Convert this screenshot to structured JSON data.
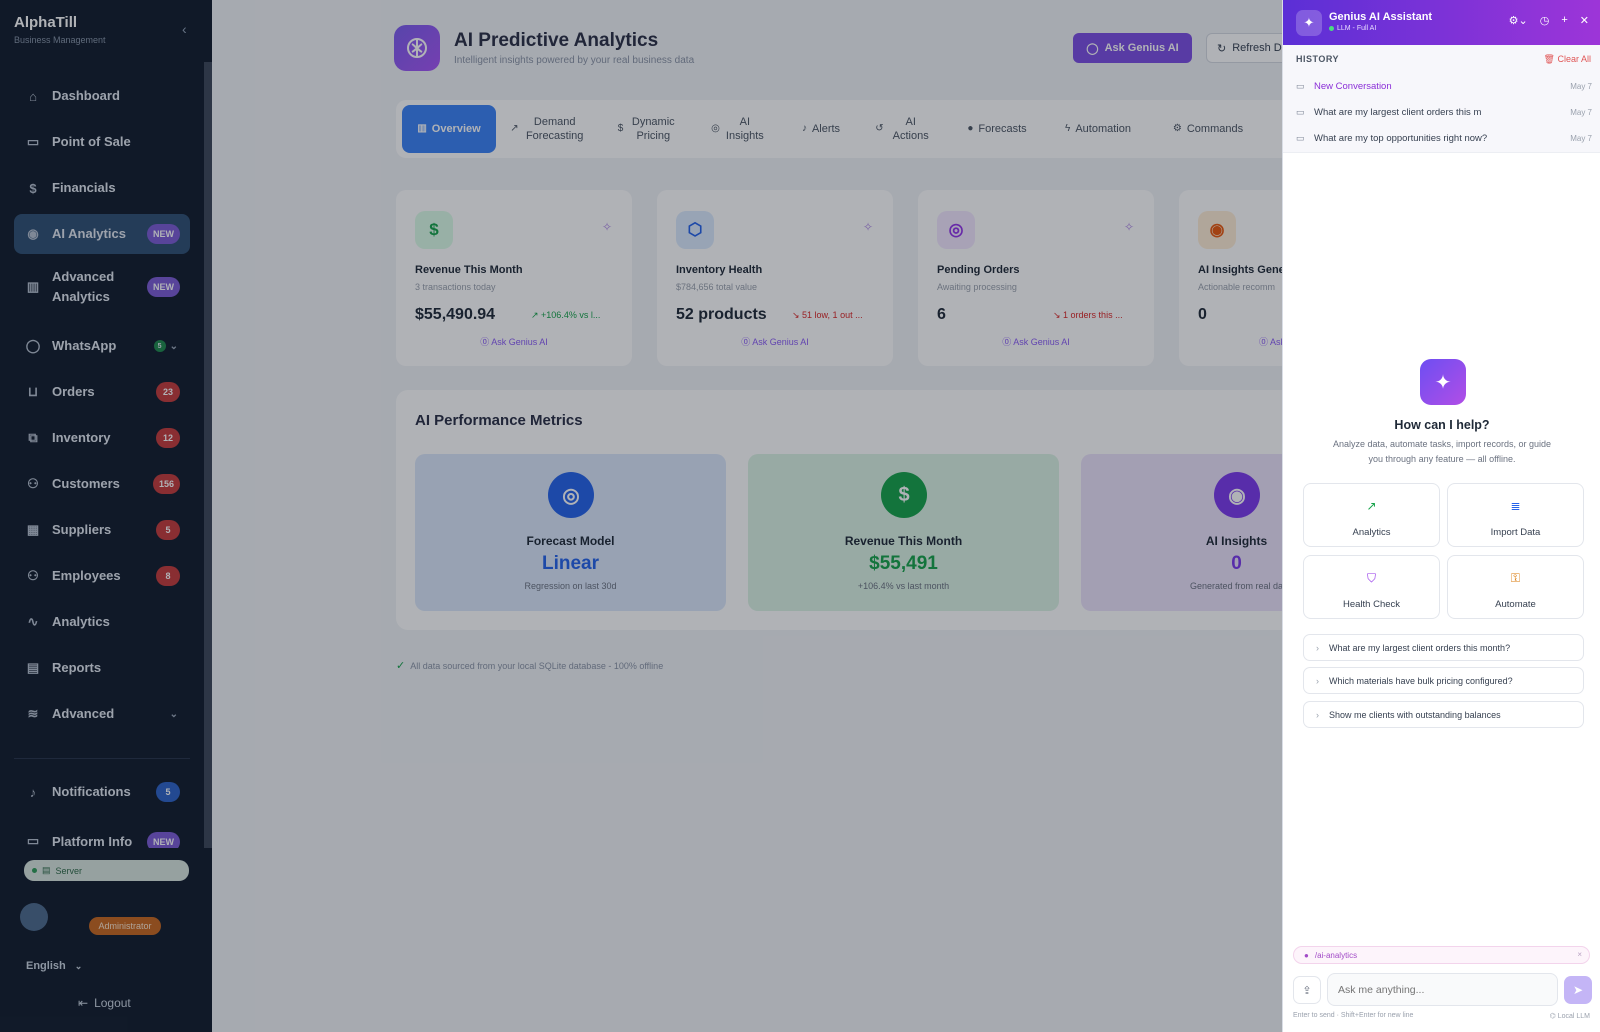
{
  "sidebar": {
    "brand_name": "AlphaTill",
    "brand_sub": "Business Management",
    "collapse_icon": "‹",
    "items": [
      {
        "label": "Dashboard",
        "icon": "⌂"
      },
      {
        "label": "Point of Sale",
        "icon": "▭"
      },
      {
        "label": "Financials",
        "icon": "$"
      },
      {
        "label": "AI Analytics",
        "icon": "◉",
        "badge": "NEW"
      },
      {
        "label": "Advanced Analytics",
        "icon": "▥",
        "badge": "NEW"
      },
      {
        "label": "WhatsApp",
        "icon": "◯",
        "badge": "5"
      },
      {
        "label": "Orders",
        "icon": "⊔",
        "badge": "23"
      },
      {
        "label": "Inventory",
        "icon": "⧉",
        "badge": "12"
      },
      {
        "label": "Customers",
        "icon": "⚇",
        "badge": "156"
      },
      {
        "label": "Suppliers",
        "icon": "▦",
        "badge": "5"
      },
      {
        "label": "Employees",
        "icon": "⚇",
        "badge": "8"
      },
      {
        "label": "Analytics",
        "icon": "∿"
      },
      {
        "label": "Reports",
        "icon": "▤"
      },
      {
        "label": "Advanced",
        "icon": "≋"
      },
      {
        "label": "Notifications",
        "icon": "♪",
        "badge": "5"
      },
      {
        "label": "Platform Info",
        "icon": "▭",
        "badge": "NEW"
      }
    ],
    "server_label": "Server",
    "role": "Administrator",
    "language": "English",
    "logout": "Logout"
  },
  "header": {
    "title": "AI Predictive Analytics",
    "subtitle": "Intelligent insights powered by your real business data",
    "ask_button": "Ask Genius AI",
    "refresh_button": "Refresh D"
  },
  "tabs": [
    {
      "label": "Overview",
      "icon": "▥"
    },
    {
      "label": "Demand Forecasting",
      "icon": "↗"
    },
    {
      "label": "Dynamic Pricing",
      "icon": "$"
    },
    {
      "label": "AI Insights",
      "icon": "◎"
    },
    {
      "label": "Alerts",
      "icon": "♪"
    },
    {
      "label": "AI Actions",
      "icon": "↺"
    },
    {
      "label": "Forecasts",
      "icon": "●"
    },
    {
      "label": "Automation",
      "icon": "ϟ"
    },
    {
      "label": "Commands",
      "icon": "⚙"
    }
  ],
  "stat_cards": [
    {
      "title": "Revenue This Month",
      "sub": "3 transactions today",
      "value": "$55,490.94",
      "trend": "↗ +106.4% vs l...",
      "ask": "⓪ Ask Genius AI",
      "icon": "$",
      "color": "#16a34a"
    },
    {
      "title": "Inventory Health",
      "sub": "$784,656 total value",
      "value": "52 products",
      "trend": "↘ 51 low, 1 out ...",
      "ask": "⓪ Ask Genius AI",
      "icon": "⬡",
      "color": "#2563eb"
    },
    {
      "title": "Pending Orders",
      "sub": "Awaiting processing",
      "value": "6",
      "trend": "↘ 1 orders this ...",
      "ask": "⓪ Ask Genius AI",
      "icon": "◎",
      "color": "#9333ea"
    },
    {
      "title": "AI Insights Gene",
      "sub": "Actionable recomm",
      "value": "0",
      "ask": "⓪ Ask",
      "icon": "◉",
      "color": "#ea580c"
    }
  ],
  "metrics": {
    "title": "AI Performance Metrics",
    "items": [
      {
        "label": "Forecast Model",
        "value": "Linear",
        "sub": "Regression on last 30d",
        "icon": "◎",
        "color": "#2563eb",
        "bg": "#dbe8fb"
      },
      {
        "label": "Revenue This Month",
        "value": "$55,491",
        "sub": "+106.4% vs last month",
        "icon": "$",
        "color": "#16a34a",
        "bg": "#dcf3e4"
      },
      {
        "label": "AI Insights",
        "value": "0",
        "sub": "Generated from real da",
        "icon": "◉",
        "color": "#7c3aed",
        "bg": "#ece3fb"
      }
    ]
  },
  "footnote": "All data sourced from your local SQLite database - 100% offline",
  "assistant": {
    "title": "Genius AI Assistant",
    "subtitle": "LLM - Full AI",
    "history_title": "HISTORY",
    "clear_all": "Clear All",
    "history": [
      {
        "text": "New Conversation",
        "date": "May 7"
      },
      {
        "text": "What are my largest client orders this m",
        "date": "May 7"
      },
      {
        "text": "What are my top opportunities right now?",
        "date": "May 7"
      }
    ],
    "help_title": "How can I help?",
    "help_sub": "Analyze data, automate tasks, import records, or guide you through any feature — all offline.",
    "quick_actions": [
      {
        "label": "Analytics",
        "icon": "↗",
        "color": "#16a34a"
      },
      {
        "label": "Import Data",
        "icon": "≣",
        "color": "#2563eb"
      },
      {
        "label": "Health Check",
        "icon": "⛉",
        "color": "#9333ea"
      },
      {
        "label": "Automate",
        "icon": "⚿",
        "color": "#d97706"
      }
    ],
    "suggestions": [
      "What are my largest client orders this month?",
      "Which materials have bulk pricing configured?",
      "Show me clients with outstanding balances"
    ],
    "context_chip": "/ai-analytics",
    "input_placeholder": "Ask me anything...",
    "hint": "Enter to send · Shift+Enter for new line",
    "local_llm": "Local LLM"
  }
}
